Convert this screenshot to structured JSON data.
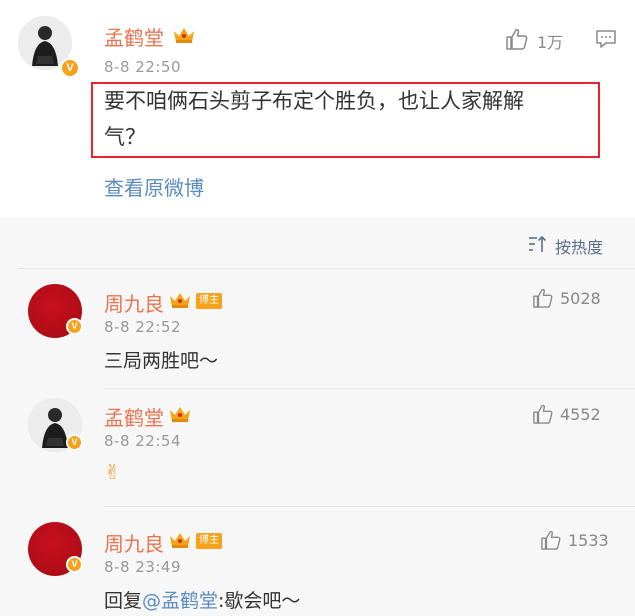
{
  "post": {
    "author": "孟鹤堂",
    "timestamp": "8-8 22:50",
    "text_line1": "要不咱俩石头剪子布定个胜负，也让人家解解",
    "text_line2": "气？",
    "likes": "1万",
    "view_original": "查看原微博"
  },
  "sort": {
    "label": "按热度"
  },
  "comments": [
    {
      "author": "周九良",
      "badge": "博主",
      "timestamp": "8-8 22:52",
      "text": "三局两胜吧～",
      "likes": "5028"
    },
    {
      "author": "孟鹤堂",
      "timestamp": "8-8 22:54",
      "text": "✌",
      "likes": "4552"
    },
    {
      "author": "周九良",
      "badge": "博主",
      "timestamp": "8-8 23:49",
      "reply_prefix": "回复",
      "mention": "@孟鹤堂",
      "reply_text": ":歇会吧～",
      "likes": "1533"
    }
  ],
  "colors": {
    "username": "#eb7350",
    "link": "#5a8cc0",
    "highlight_border": "#e8242c",
    "badge": "#f7a21b"
  },
  "icons": {
    "like": "thumbs-up-icon",
    "comment": "comment-icon",
    "verified": "verified-v-icon",
    "crown": "crown-icon",
    "sort": "sort-icon"
  }
}
